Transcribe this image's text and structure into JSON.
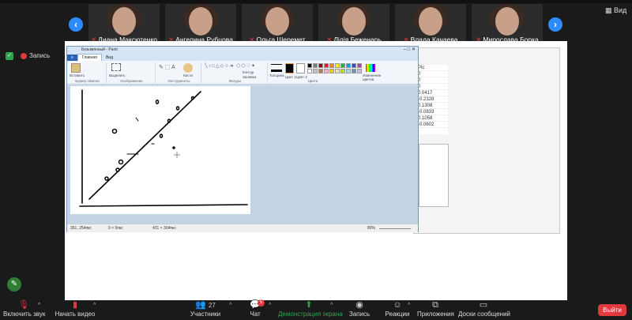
{
  "participants": [
    {
      "name": "Диана Максютенко"
    },
    {
      "name": "Ангелина Рубцова"
    },
    {
      "name": "Ольга Шеремет"
    },
    {
      "name": "Лілія Беженарь"
    },
    {
      "name": "Влада Качаева"
    },
    {
      "name": "Мирослава Борка"
    }
  ],
  "view_label": "Вид",
  "recording_label": "Запись",
  "paint": {
    "title": "Безымянный - Paint",
    "tabs": [
      "Главная",
      "Вид"
    ],
    "groups": [
      "Буфер обмена",
      "Изображение",
      "Инструменты",
      "Фигуры",
      "Цвета"
    ],
    "buttons": [
      "Вставить",
      "Выделить",
      "Кисти",
      "Контур",
      "Заливка",
      "Толщина",
      "Цвет 1",
      "Цвет 2",
      "Изменение цветов"
    ],
    "status": {
      "cursor": "351, 254пкс",
      "selection": "0 × 0пкс",
      "size": "431 × 304пкс",
      "zoom": "80%"
    }
  },
  "excel_values": [
    "Pic",
    "0",
    "0",
    "0",
    "0.0417",
    "-0.2328",
    "0.1308",
    "-0.0833",
    "0.1058",
    "-0.0602"
  ],
  "toolbar": {
    "mute": "Включить звук",
    "video": "Начать видео",
    "participants": "Участники",
    "participants_count": "27",
    "chat": "Чат",
    "chat_badge": "5",
    "share": "Демонстрация экрана",
    "record": "Запись",
    "reactions": "Реакции",
    "apps": "Приложения",
    "whiteboards": "Доски сообщений",
    "leave": "Выйти"
  },
  "colors": {
    "accent": "#2d8cff",
    "danger": "#e0393e",
    "share": "#2ea44f"
  }
}
